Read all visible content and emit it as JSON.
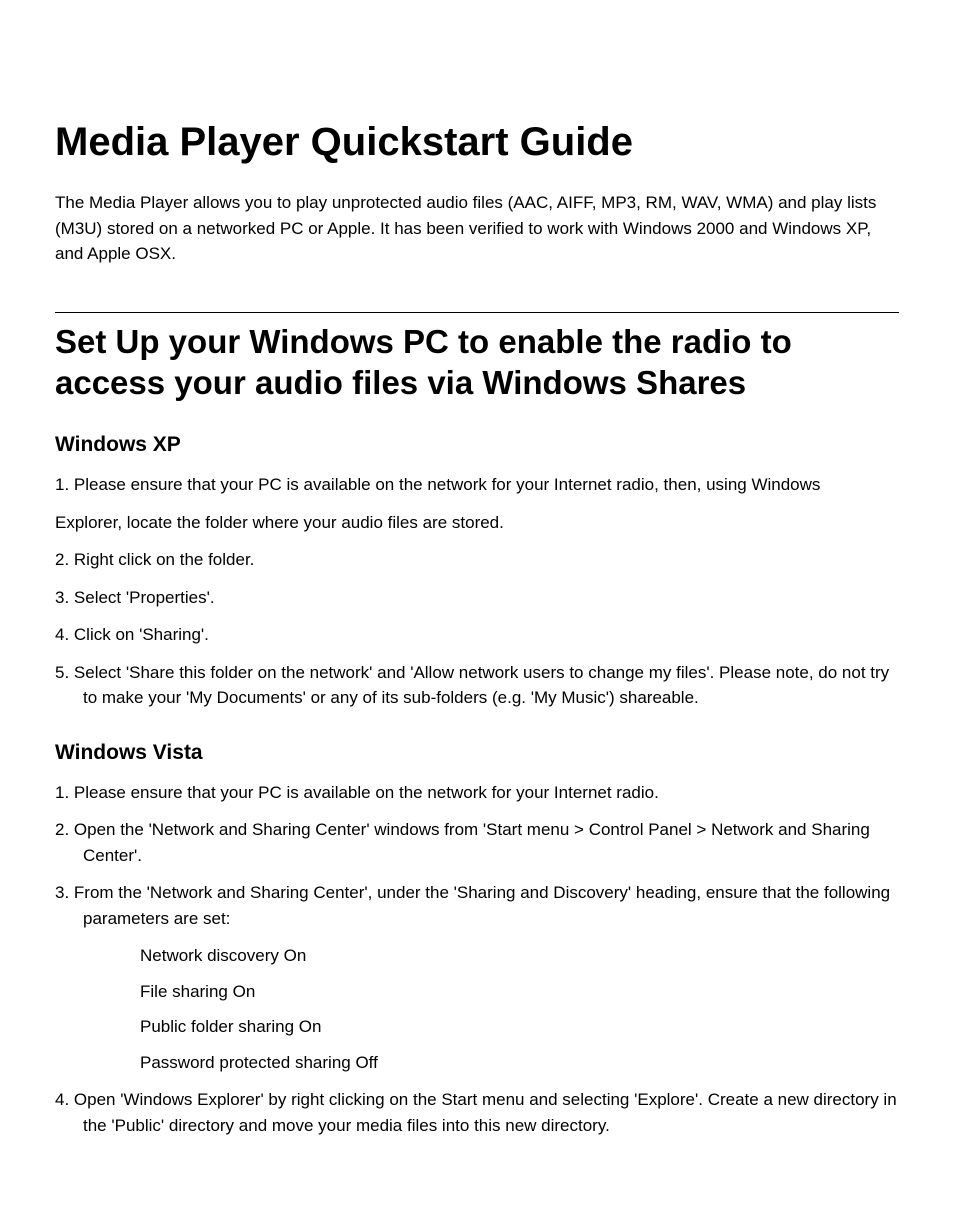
{
  "title": "Media Player Quickstart Guide",
  "intro": "The Media Player allows you to play unprotected audio files (AAC, AIFF, MP3, RM, WAV, WMA) and play lists (M3U) stored on a networked PC or Apple. It has been verified to work with Windows 2000 and Windows XP, and Apple OSX.",
  "section1": {
    "heading": "Set Up your Windows PC to enable the radio to access your audio files via Windows Shares",
    "xp": {
      "heading": "Windows XP",
      "step1a": "1. Please ensure that your PC is available on the network for your Internet radio, then, using Windows",
      "step1b": "Explorer, locate the folder where your audio files are stored.",
      "step2": "2. Right click on the folder.",
      "step3": "3. Select 'Properties'.",
      "step4": "4. Click on 'Sharing'.",
      "step5": "5. Select 'Share this folder on the network' and 'Allow network users to change my files'. Please note, do not try to make your 'My Documents' or any of its sub-folders (e.g. 'My Music') shareable."
    },
    "vista": {
      "heading": "Windows Vista",
      "step1": "1. Please ensure that your PC is available on the network for your Internet radio.",
      "step2": "2. Open the 'Network and Sharing Center' windows from 'Start menu > Control Panel > Network and Sharing Center'.",
      "step3": "3. From the 'Network and Sharing Center', under the 'Sharing and Discovery' heading, ensure that the following parameters are set:",
      "bullets": {
        "b1": "Network discovery On",
        "b2": "File sharing On",
        "b3": "Public folder sharing On",
        "b4": "Password protected sharing Off"
      },
      "step4": "4. Open 'Windows Explorer' by right clicking on the Start menu and selecting 'Explore'. Create a new directory in the 'Public' directory and move your media files into this new directory."
    }
  }
}
